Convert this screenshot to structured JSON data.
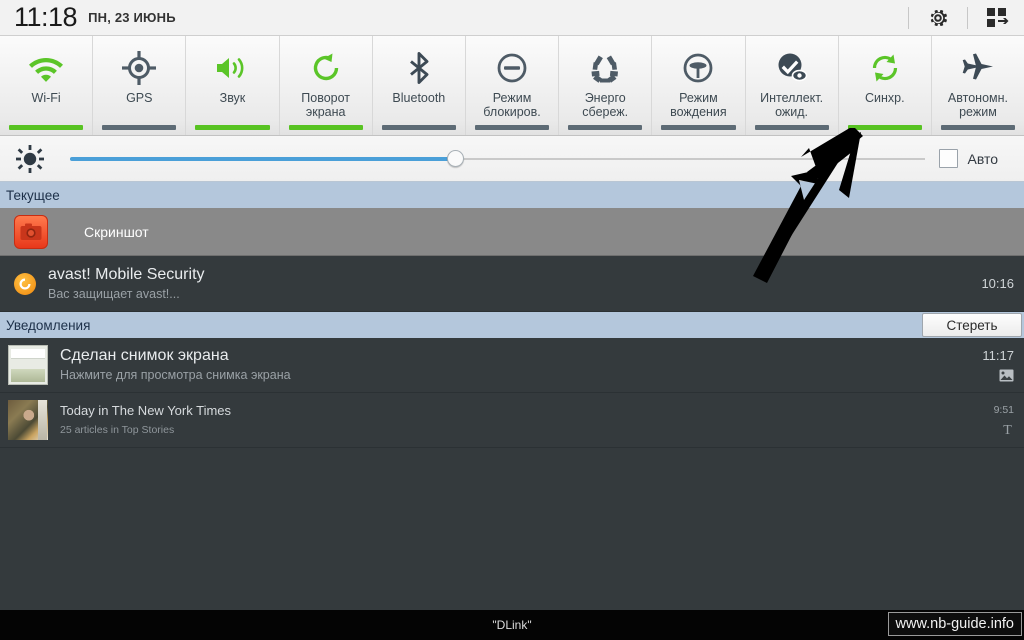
{
  "statusbar": {
    "time": "11:18",
    "date": "пн, 23 июнь",
    "icons": [
      {
        "name": "gear-icon",
        "glyph": "settings"
      },
      {
        "name": "multiwindow-icon",
        "glyph": "grid"
      }
    ]
  },
  "quick_toggles": [
    {
      "label": "Wi-Fi",
      "icon": "wifi-icon",
      "state": "on"
    },
    {
      "label": "GPS",
      "icon": "gps-icon",
      "state": "off"
    },
    {
      "label": "Звук",
      "icon": "sound-icon",
      "state": "on"
    },
    {
      "label": "Поворот\nэкрана",
      "icon": "rotate-icon",
      "state": "on"
    },
    {
      "label": "Bluetooth",
      "icon": "bluetooth-icon",
      "state": "off"
    },
    {
      "label": "Режим\nблокиров.",
      "icon": "blocking-mode-icon",
      "state": "off"
    },
    {
      "label": "Энерго\nсбереж.",
      "icon": "power-saving-icon",
      "state": "off"
    },
    {
      "label": "Режим\nвождения",
      "icon": "driving-mode-icon",
      "state": "off"
    },
    {
      "label": "Интеллект.\nожид.",
      "icon": "smart-stay-icon",
      "state": "off"
    },
    {
      "label": "Синхр.",
      "icon": "sync-icon",
      "state": "on"
    },
    {
      "label": "Автономн.\nрежим",
      "icon": "airplane-icon",
      "state": "off"
    }
  ],
  "brightness": {
    "icon": "brightness-icon",
    "value_percent": 45,
    "auto_label": "Авто",
    "auto_checked": false
  },
  "sections": {
    "ongoing_title": "Текущее",
    "notifications_title": "Уведомления",
    "clear_label": "Стереть"
  },
  "ongoing": [
    {
      "icon": "camera-icon",
      "label": "Скриншот"
    }
  ],
  "persistent": [
    {
      "icon": "avast-icon",
      "title": "avast! Mobile Security",
      "subtitle": "Вас защищает avast!...",
      "time": "10:16"
    }
  ],
  "notifications": [
    {
      "thumb": "screenshot-thumbnail",
      "title": "Сделан снимок экрана",
      "subtitle": "Нажмите для просмотра снимка экрана",
      "time": "11:17",
      "badge": "image-icon"
    },
    {
      "thumb": "nyt-thumbnail",
      "title": "Today in The New York Times",
      "subtitle": "25 articles in Top Stories",
      "time": "9:51",
      "badge": "nyt-logo-icon"
    }
  ],
  "annotation": {
    "type": "arrow",
    "points_to": "Синхр."
  },
  "bottom_bar": {
    "network": "\"DLink\"",
    "watermark": "www.nb-guide.info"
  },
  "colors": {
    "toggle_on": "#58c322",
    "toggle_off": "#5d6b75",
    "section_header": "#b4c7dc",
    "panel_bg": "#343a3d",
    "slider_fill": "#4a9fd8"
  }
}
